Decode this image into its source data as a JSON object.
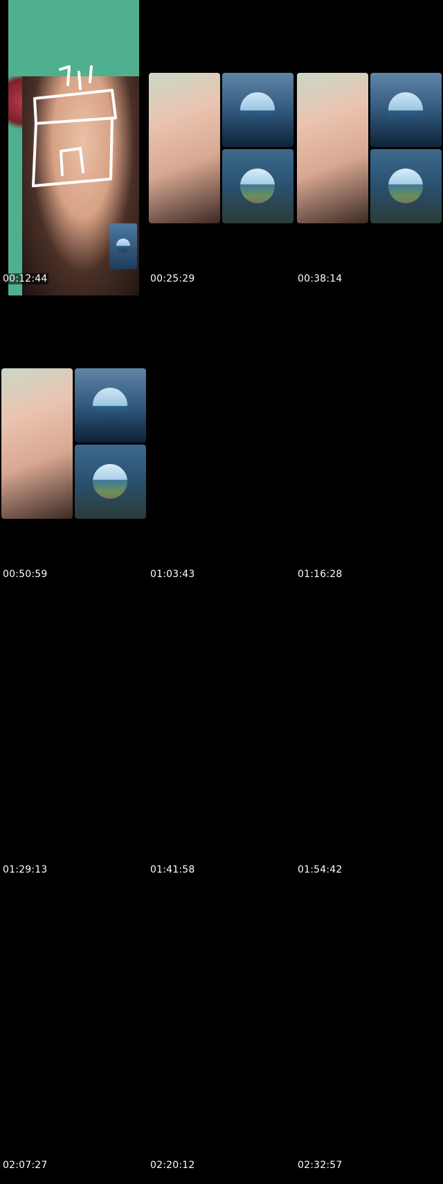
{
  "timestamps": [
    "00:12:44",
    "00:25:29",
    "00:38:14",
    "00:50:59",
    "01:03:43",
    "01:16:28",
    "01:29:13",
    "01:41:58",
    "01:54:42",
    "02:07:27",
    "02:20:12",
    "02:32:57"
  ],
  "colors": {
    "background": "#000000",
    "timestamp_text": "#ffffff",
    "wall_green": "#4fb08f"
  }
}
